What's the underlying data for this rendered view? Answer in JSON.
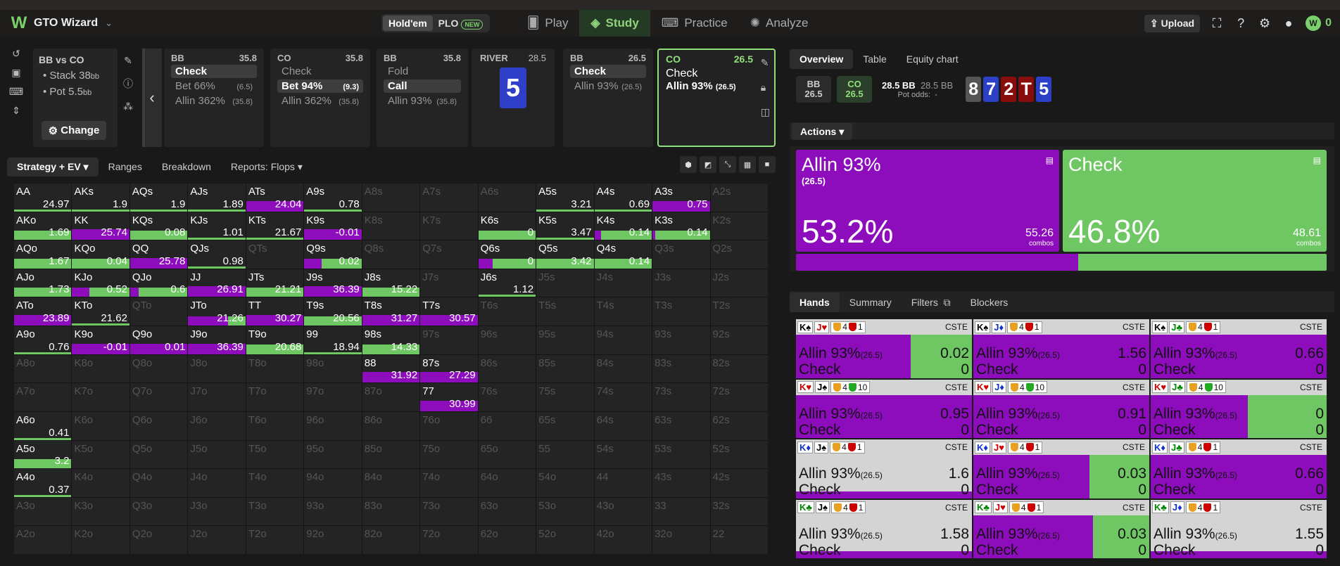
{
  "app": {
    "brand": "GTO Wizard",
    "coins": "0",
    "upload": "Upload"
  },
  "game_toggle": {
    "holdem": "Hold'em",
    "plo": "PLO",
    "new": "NEW"
  },
  "nav": {
    "play": "Play",
    "study": "Study",
    "practice": "Practice",
    "analyze": "Analyze"
  },
  "spot": {
    "title": "BB vs CO",
    "stack": "Stack 38",
    "stack_unit": "bb",
    "pot": "Pot 5.5",
    "pot_unit": "bb",
    "change": "Change"
  },
  "cards": [
    {
      "pos": "BB",
      "stack": "35.8",
      "opts": [
        {
          "label": "Check",
          "amt": "",
          "sel": true
        },
        {
          "label": "Bet 66%",
          "amt": "(6.5)",
          "sel": false
        },
        {
          "label": "Allin 362%",
          "amt": "(35.8)",
          "sel": false
        }
      ]
    },
    {
      "pos": "CO",
      "stack": "35.8",
      "opts": [
        {
          "label": "Check",
          "amt": "",
          "sel": false
        },
        {
          "label": "Bet 94%",
          "amt": "(9.3)",
          "sel": true
        },
        {
          "label": "Allin 362%",
          "amt": "(35.8)",
          "sel": false
        }
      ]
    },
    {
      "pos": "BB",
      "stack": "35.8",
      "opts": [
        {
          "label": "Fold",
          "amt": "",
          "sel": false
        },
        {
          "label": "Call",
          "amt": "",
          "sel": true
        },
        {
          "label": "Allin 93%",
          "amt": "(35.8)",
          "sel": false
        }
      ]
    },
    {
      "pos": "BB",
      "stack": "26.5",
      "opts": [
        {
          "label": "Check",
          "amt": "",
          "sel": true
        },
        {
          "label": "Allin 93%",
          "amt": "(26.5)",
          "sel": false
        }
      ]
    }
  ],
  "river": {
    "label": "RIVER",
    "pot": "28.5",
    "card": "5"
  },
  "current": {
    "pos": "CO",
    "stack": "26.5",
    "opt1": "Check",
    "opt2": "Allin 93%",
    "opt2_amt": "(26.5)"
  },
  "subtabs": [
    "Strategy + EV",
    "Ranges",
    "Breakdown",
    "Reports: Flops"
  ],
  "matrix": [
    [
      [
        "AA",
        "24.97",
        0.0,
        0.1
      ],
      [
        "AKs",
        "1.9",
        0.0,
        0.1
      ],
      [
        "AQs",
        "1.9",
        0.0,
        0.1
      ],
      [
        "AJs",
        "1.89",
        0.0,
        0.1
      ],
      [
        "ATs",
        "24.04",
        0.0,
        1.0
      ],
      [
        "A9s",
        "0.78",
        0.0,
        0.1
      ],
      [
        "A8s",
        "",
        0,
        0
      ],
      [
        "A7s",
        "",
        0,
        0
      ],
      [
        "A6s",
        "",
        0,
        0
      ],
      [
        "A5s",
        "3.21",
        0.0,
        0.1
      ],
      [
        "A4s",
        "0.69",
        0.0,
        0.1
      ],
      [
        "A3s",
        "0.75",
        0.0,
        1.0
      ],
      [
        "A2s",
        "",
        0,
        0
      ]
    ],
    [
      [
        "AKo",
        "1.69",
        1.0,
        0.0
      ],
      [
        "KK",
        "25.74",
        0.0,
        1.0
      ],
      [
        "KQs",
        "0.08",
        1.0,
        0.0
      ],
      [
        "KJs",
        "1.01",
        0.0,
        0.1
      ],
      [
        "KTs",
        "21.67",
        0.0,
        0.1
      ],
      [
        "K9s",
        "-0.01",
        0.0,
        1.0
      ],
      [
        "K8s",
        "",
        0,
        0
      ],
      [
        "K7s",
        "",
        0,
        0
      ],
      [
        "K6s",
        "0",
        1.0,
        0.0
      ],
      [
        "K5s",
        "3.47",
        0.0,
        0.1
      ],
      [
        "K4s",
        "0.14",
        0.88,
        0.12
      ],
      [
        "K3s",
        "0.14",
        0.95,
        0.05
      ],
      [
        "K2s",
        "",
        0,
        0
      ]
    ],
    [
      [
        "AQo",
        "1.67",
        1.0,
        0.0
      ],
      [
        "KQo",
        "0.04",
        1.0,
        0.0
      ],
      [
        "QQ",
        "25.78",
        0.0,
        1.0
      ],
      [
        "QJs",
        "0.98",
        0.0,
        0.1
      ],
      [
        "QTs",
        "",
        0,
        0
      ],
      [
        "Q9s",
        "0.02",
        0.7,
        0.3
      ],
      [
        "Q8s",
        "",
        0,
        0
      ],
      [
        "Q7s",
        "",
        0,
        0
      ],
      [
        "Q6s",
        "0",
        0.75,
        0.25
      ],
      [
        "Q5s",
        "3.42",
        1.0,
        0.0
      ],
      [
        "Q4s",
        "0.14",
        1.0,
        0.0
      ],
      [
        "Q3s",
        "",
        0,
        0
      ],
      [
        "Q2s",
        "",
        0,
        0
      ]
    ],
    [
      [
        "AJo",
        "1.73",
        1.0,
        0.0
      ],
      [
        "KJo",
        "0.52",
        0.7,
        0.3
      ],
      [
        "QJo",
        "0.6",
        0.85,
        0.15
      ],
      [
        "JJ",
        "26.91",
        0.0,
        1.0
      ],
      [
        "JTs",
        "21.21",
        1.0,
        0.0
      ],
      [
        "J9s",
        "36.39",
        0.0,
        1.0
      ],
      [
        "J8s",
        "15.22",
        1.0,
        0.0
      ],
      [
        "J7s",
        "",
        0,
        0
      ],
      [
        "J6s",
        "1.12",
        0.0,
        0.1
      ],
      [
        "J5s",
        "",
        0,
        0
      ],
      [
        "J4s",
        "",
        0,
        0
      ],
      [
        "J3s",
        "",
        0,
        0
      ],
      [
        "J2s",
        "",
        0,
        0
      ]
    ],
    [
      [
        "ATo",
        "23.89",
        0.0,
        1.0
      ],
      [
        "KTo",
        "21.62",
        0.0,
        0.1
      ],
      [
        "QTo",
        "",
        0,
        0
      ],
      [
        "JTo",
        "21.26",
        0.3,
        0.7
      ],
      [
        "TT",
        "30.27",
        0.0,
        1.0
      ],
      [
        "T9s",
        "20.56",
        1.0,
        0.0
      ],
      [
        "T8s",
        "31.27",
        0.0,
        1.0
      ],
      [
        "T7s",
        "30.57",
        0.0,
        1.0
      ],
      [
        "T6s",
        "",
        0,
        0
      ],
      [
        "T5s",
        "",
        0,
        0
      ],
      [
        "T4s",
        "",
        0,
        0
      ],
      [
        "T3s",
        "",
        0,
        0
      ],
      [
        "T2s",
        "",
        0,
        0
      ]
    ],
    [
      [
        "A9o",
        "0.76",
        0.0,
        0.1
      ],
      [
        "K9o",
        "-0.01",
        0.0,
        1.0
      ],
      [
        "Q9o",
        "0.01",
        0.0,
        1.0
      ],
      [
        "J9o",
        "36.39",
        0.0,
        1.0
      ],
      [
        "T9o",
        "20.68",
        1.0,
        0.0
      ],
      [
        "99",
        "18.94",
        0.0,
        0.1
      ],
      [
        "98s",
        "14.33",
        1.0,
        0.0
      ],
      [
        "97s",
        "",
        0,
        0
      ],
      [
        "96s",
        "",
        0,
        0
      ],
      [
        "95s",
        "",
        0,
        0
      ],
      [
        "94s",
        "",
        0,
        0
      ],
      [
        "93s",
        "",
        0,
        0
      ],
      [
        "92s",
        "",
        0,
        0
      ]
    ],
    [
      [
        "A8o",
        "",
        0,
        0
      ],
      [
        "K8o",
        "",
        0,
        0
      ],
      [
        "Q8o",
        "",
        0,
        0
      ],
      [
        "J8o",
        "",
        0,
        0
      ],
      [
        "T8o",
        "",
        0,
        0
      ],
      [
        "98o",
        "",
        0,
        0
      ],
      [
        "88",
        "31.92",
        0.0,
        1.0
      ],
      [
        "87s",
        "27.29",
        0.0,
        1.0
      ],
      [
        "86s",
        "",
        0,
        0
      ],
      [
        "85s",
        "",
        0,
        0
      ],
      [
        "84s",
        "",
        0,
        0
      ],
      [
        "83s",
        "",
        0,
        0
      ],
      [
        "82s",
        "",
        0,
        0
      ]
    ],
    [
      [
        "A7o",
        "",
        0,
        0
      ],
      [
        "K7o",
        "",
        0,
        0
      ],
      [
        "Q7o",
        "",
        0,
        0
      ],
      [
        "J7o",
        "",
        0,
        0
      ],
      [
        "T7o",
        "",
        0,
        0
      ],
      [
        "97o",
        "",
        0,
        0
      ],
      [
        "87o",
        "",
        0,
        0
      ],
      [
        "77",
        "30.99",
        0.0,
        1.0
      ],
      [
        "76s",
        "",
        0,
        0
      ],
      [
        "75s",
        "",
        0,
        0
      ],
      [
        "74s",
        "",
        0,
        0
      ],
      [
        "73s",
        "",
        0,
        0
      ],
      [
        "72s",
        "",
        0,
        0
      ]
    ],
    [
      [
        "A6o",
        "0.41",
        0.0,
        0.1
      ],
      [
        "K6o",
        "",
        0,
        0
      ],
      [
        "Q6o",
        "",
        0,
        0
      ],
      [
        "J6o",
        "",
        0,
        0
      ],
      [
        "T6o",
        "",
        0,
        0
      ],
      [
        "96o",
        "",
        0,
        0
      ],
      [
        "86o",
        "",
        0,
        0
      ],
      [
        "76o",
        "",
        0,
        0
      ],
      [
        "66",
        "",
        0,
        0
      ],
      [
        "65s",
        "",
        0,
        0
      ],
      [
        "64s",
        "",
        0,
        0
      ],
      [
        "63s",
        "",
        0,
        0
      ],
      [
        "62s",
        "",
        0,
        0
      ]
    ],
    [
      [
        "A5o",
        "3.2",
        1.0,
        0.0
      ],
      [
        "K5o",
        "",
        0,
        0
      ],
      [
        "Q5o",
        "",
        0,
        0
      ],
      [
        "J5o",
        "",
        0,
        0
      ],
      [
        "T5o",
        "",
        0,
        0
      ],
      [
        "95o",
        "",
        0,
        0
      ],
      [
        "85o",
        "",
        0,
        0
      ],
      [
        "75o",
        "",
        0,
        0
      ],
      [
        "65o",
        "",
        0,
        0
      ],
      [
        "55",
        "",
        0,
        0
      ],
      [
        "54s",
        "",
        0,
        0
      ],
      [
        "53s",
        "",
        0,
        0
      ],
      [
        "52s",
        "",
        0,
        0
      ]
    ],
    [
      [
        "A4o",
        "0.37",
        0.0,
        0.1
      ],
      [
        "K4o",
        "",
        0,
        0
      ],
      [
        "Q4o",
        "",
        0,
        0
      ],
      [
        "J4o",
        "",
        0,
        0
      ],
      [
        "T4o",
        "",
        0,
        0
      ],
      [
        "94o",
        "",
        0,
        0
      ],
      [
        "84o",
        "",
        0,
        0
      ],
      [
        "74o",
        "",
        0,
        0
      ],
      [
        "64o",
        "",
        0,
        0
      ],
      [
        "54o",
        "",
        0,
        0
      ],
      [
        "44",
        "",
        0,
        0
      ],
      [
        "43s",
        "",
        0,
        0
      ],
      [
        "42s",
        "",
        0,
        0
      ]
    ],
    [
      [
        "A3o",
        "",
        0,
        0
      ],
      [
        "K3o",
        "",
        0,
        0
      ],
      [
        "Q3o",
        "",
        0,
        0
      ],
      [
        "J3o",
        "",
        0,
        0
      ],
      [
        "T3o",
        "",
        0,
        0
      ],
      [
        "93o",
        "",
        0,
        0
      ],
      [
        "83o",
        "",
        0,
        0
      ],
      [
        "73o",
        "",
        0,
        0
      ],
      [
        "63o",
        "",
        0,
        0
      ],
      [
        "53o",
        "",
        0,
        0
      ],
      [
        "43o",
        "",
        0,
        0
      ],
      [
        "33",
        "",
        0,
        0
      ],
      [
        "32s",
        "",
        0,
        0
      ]
    ],
    [
      [
        "A2o",
        "",
        0,
        0
      ],
      [
        "K2o",
        "",
        0,
        0
      ],
      [
        "Q2o",
        "",
        0,
        0
      ],
      [
        "J2o",
        "",
        0,
        0
      ],
      [
        "T2o",
        "",
        0,
        0
      ],
      [
        "92o",
        "",
        0,
        0
      ],
      [
        "82o",
        "",
        0,
        0
      ],
      [
        "72o",
        "",
        0,
        0
      ],
      [
        "62o",
        "",
        0,
        0
      ],
      [
        "52o",
        "",
        0,
        0
      ],
      [
        "42o",
        "",
        0,
        0
      ],
      [
        "32o",
        "",
        0,
        0
      ],
      [
        "22",
        "",
        0,
        0
      ]
    ]
  ],
  "right_tabs": [
    "Overview",
    "Table",
    "Equity chart"
  ],
  "pot": {
    "bb_label": "BB",
    "bb_val": "26.5",
    "co_label": "CO",
    "co_val": "26.5",
    "pot1": "28.5 BB",
    "pot2": "28.5 BB",
    "odds_label": "Pot odds:",
    "odds_val": "-"
  },
  "board": [
    {
      "r": "8",
      "c": "#555"
    },
    {
      "r": "7",
      "c": "#2b3fc7"
    },
    {
      "r": "2",
      "c": "#8a0d0d"
    },
    {
      "r": "T",
      "c": "#8a0d0d"
    },
    {
      "r": "5",
      "c": "#2b3fc7"
    }
  ],
  "actions_label": "Actions",
  "action_boxes": [
    {
      "name": "Allin 93%",
      "amt": "(26.5)",
      "pct": "53.2%",
      "combos": "55.26",
      "combos_label": "combos",
      "color": "#8d0cbc"
    },
    {
      "name": "Check",
      "amt": "",
      "pct": "46.8%",
      "combos": "48.61",
      "combos_label": "combos",
      "color": "#6ec762"
    }
  ],
  "freq": {
    "allin": 53.2,
    "check": 46.8
  },
  "hand_tabs": [
    "Hands",
    "Summary",
    "Filters",
    "Blockers"
  ],
  "hands": [
    {
      "c1": "K♠",
      "c1c": "k",
      "c2": "J♥",
      "c2c": "r",
      "n1": "4",
      "n2": "1",
      "sh2": "#c00",
      "tag": "CSTE",
      "allin_amt": "(26.5)",
      "ev1": "0.02",
      "ev2": "0",
      "green": 0.35
    },
    {
      "c1": "K♠",
      "c1c": "k",
      "c2": "J♦",
      "c2c": "b",
      "n1": "4",
      "n2": "1",
      "sh2": "#c00",
      "tag": "CSTE",
      "allin_amt": "(26.5)",
      "ev1": "1.56",
      "ev2": "0",
      "green": 0.0
    },
    {
      "c1": "K♠",
      "c1c": "k",
      "c2": "J♣",
      "c2c": "g",
      "n1": "4",
      "n2": "1",
      "sh2": "#c00",
      "tag": "CSTE",
      "allin_amt": "(26.5)",
      "ev1": "0.66",
      "ev2": "0",
      "green": 0.0
    },
    {
      "c1": "K♥",
      "c1c": "r",
      "c2": "J♠",
      "c2c": "k",
      "n1": "4",
      "n2": "10",
      "sh2": "#2a2",
      "tag": "CSTE",
      "allin_amt": "(26.5)",
      "ev1": "0.95",
      "ev2": "0",
      "green": 0.0
    },
    {
      "c1": "K♥",
      "c1c": "r",
      "c2": "J♦",
      "c2c": "b",
      "n1": "4",
      "n2": "10",
      "sh2": "#2a2",
      "tag": "CSTE",
      "allin_amt": "(26.5)",
      "ev1": "0.91",
      "ev2": "0",
      "green": 0.0
    },
    {
      "c1": "K♥",
      "c1c": "r",
      "c2": "J♣",
      "c2c": "g",
      "n1": "4",
      "n2": "10",
      "sh2": "#2a2",
      "tag": "CSTE",
      "allin_amt": "(26.5)",
      "ev1": "0",
      "ev2": "0",
      "green": 0.45
    },
    {
      "c1": "K♦",
      "c1c": "b",
      "c2": "J♠",
      "c2c": "k",
      "n1": "4",
      "n2": "1",
      "sh2": "#c00",
      "tag": "CSTE",
      "allin_amt": "(26.5)",
      "ev1": "1.6",
      "ev2": "0",
      "green": 0.0,
      "light": true
    },
    {
      "c1": "K♦",
      "c1c": "b",
      "c2": "J♥",
      "c2c": "r",
      "n1": "4",
      "n2": "1",
      "sh2": "#c00",
      "tag": "CSTE",
      "allin_amt": "(26.5)",
      "ev1": "0.03",
      "ev2": "0",
      "green": 0.34
    },
    {
      "c1": "K♦",
      "c1c": "b",
      "c2": "J♣",
      "c2c": "g",
      "n1": "4",
      "n2": "1",
      "sh2": "#c00",
      "tag": "CSTE",
      "allin_amt": "(26.5)",
      "ev1": "0.66",
      "ev2": "0",
      "green": 0.0
    },
    {
      "c1": "K♣",
      "c1c": "g",
      "c2": "J♠",
      "c2c": "k",
      "n1": "4",
      "n2": "1",
      "sh2": "#c00",
      "tag": "CSTE",
      "allin_amt": "(26.5)",
      "ev1": "1.58",
      "ev2": "0",
      "green": 0.0,
      "light": true
    },
    {
      "c1": "K♣",
      "c1c": "g",
      "c2": "J♥",
      "c2c": "r",
      "n1": "4",
      "n2": "1",
      "sh2": "#c00",
      "tag": "CSTE",
      "allin_amt": "(26.5)",
      "ev1": "0.03",
      "ev2": "0",
      "green": 0.32
    },
    {
      "c1": "K♣",
      "c1c": "g",
      "c2": "J♦",
      "c2c": "b",
      "n1": "4",
      "n2": "1",
      "sh2": "#c00",
      "tag": "CSTE",
      "allin_amt": "(26.5)",
      "ev1": "1.55",
      "ev2": "0",
      "green": 0.0,
      "light": true
    }
  ]
}
